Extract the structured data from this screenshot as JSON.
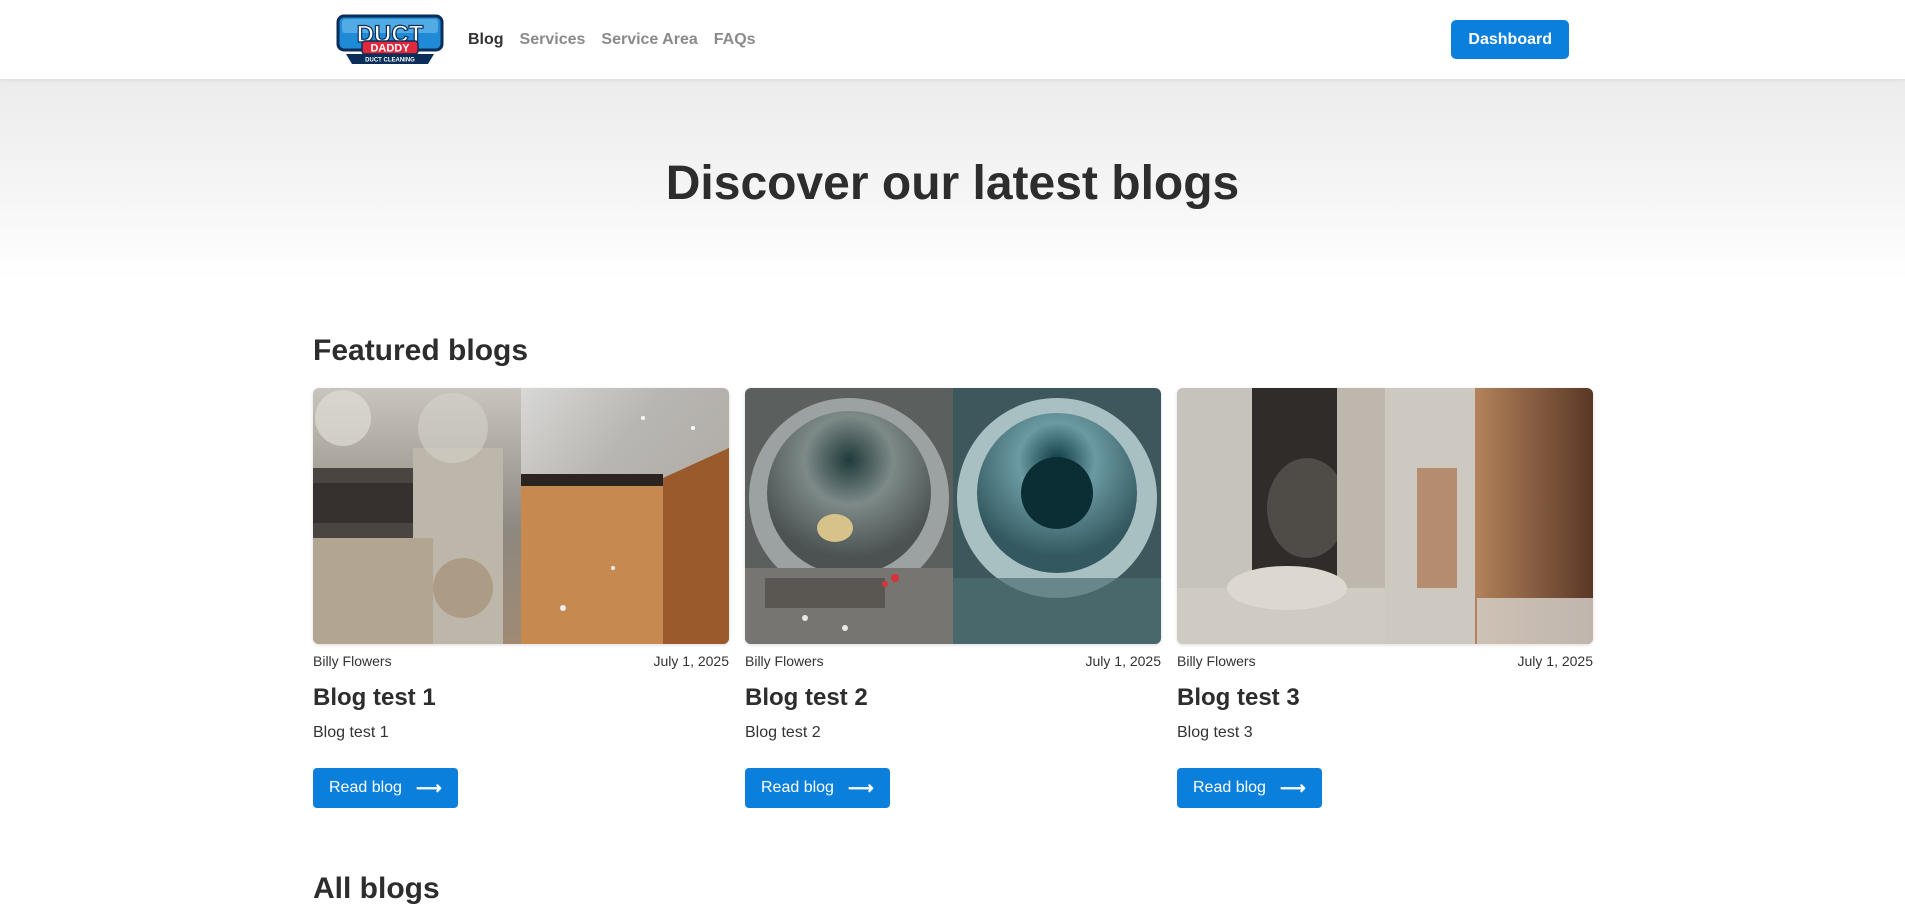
{
  "header": {
    "logo": {
      "line1": "DUCT",
      "line2": "DADDY",
      "line3": "DUCT CLEANING"
    },
    "nav": [
      {
        "label": "Blog"
      },
      {
        "label": "Services"
      },
      {
        "label": "Service Area"
      },
      {
        "label": "FAQs"
      }
    ],
    "dashboard_label": "Dashboard"
  },
  "hero": {
    "title": "Discover our latest blogs"
  },
  "featured": {
    "title": "Featured blogs",
    "cards": [
      {
        "author": "Billy Flowers",
        "date": "July 1, 2025",
        "title": "Blog test 1",
        "excerpt": "Blog test 1",
        "button": "Read blog",
        "image": "dusty-duct-before-after-photo"
      },
      {
        "author": "Billy Flowers",
        "date": "July 1, 2025",
        "title": "Blog test 2",
        "excerpt": "Blog test 2",
        "button": "Read blog",
        "image": "round-vent-pipe-before-after-photo"
      },
      {
        "author": "Billy Flowers",
        "date": "July 1, 2025",
        "title": "Blog test 3",
        "excerpt": "Blog test 3",
        "button": "Read blog",
        "image": "dusty-duct-cobweb-before-after-photo"
      }
    ]
  },
  "all_blogs": {
    "title": "All blogs"
  },
  "colors": {
    "primary": "#0a7fdc",
    "text": "#2d2d2d",
    "nav_inactive": "#8a8a8a"
  }
}
